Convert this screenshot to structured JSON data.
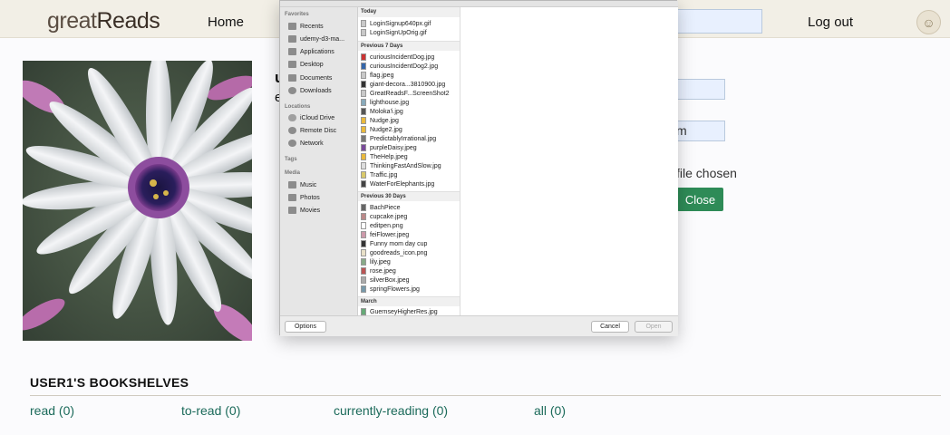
{
  "nav": {
    "logo_part1": "great",
    "logo_part2": "Reads",
    "home": "Home",
    "logout": "Log out",
    "avatar_icon": "user-avatar-icon"
  },
  "profile": {
    "name_fragment": "u",
    "sub_fragment": "e",
    "field2_fragment": "m",
    "file_status": "file chosen",
    "close_button": "Close"
  },
  "bookshelves": {
    "title": "USER1'S BOOKSHELVES",
    "links": [
      "read (0)",
      "to-read (0)",
      "currently-reading (0)",
      "all (0)"
    ]
  },
  "dialog": {
    "sidebar": {
      "favorites_heading": "Favorites",
      "favorites": [
        "Recents",
        "udemy-d3-ma...",
        "Applications",
        "Desktop",
        "Documents",
        "Downloads"
      ],
      "locations_heading": "Locations",
      "locations": [
        "iCloud Drive",
        "Remote Disc",
        "Network"
      ],
      "tags_heading": "Tags",
      "media_heading": "Media",
      "media": [
        "Music",
        "Photos",
        "Movies"
      ]
    },
    "groups": {
      "today": {
        "label": "Today",
        "files": [
          "LoginSignup640px.gif",
          "LoginSignUpOrig.gif"
        ]
      },
      "prev7": {
        "label": "Previous 7 Days",
        "files": [
          "curiousIncidentDog.jpg",
          "curiousIncidentDog2.jpg",
          "flag.jpeg",
          "giant-decora...3810900.jpg",
          "GreatReadsF...ScreenShot2",
          "lighthouse.jpg",
          "Moloka'i.jpg",
          "Nudge.jpg",
          "Nudge2.jpg",
          "PredictablyIrrational.jpg",
          "purpleDaisy.jpeg",
          "TheHelp.jpeg",
          "ThinkingFastAndSlow.jpg",
          "Traffic.jpg",
          "WaterForElephants.jpg"
        ]
      },
      "prev30": {
        "label": "Previous 30 Days",
        "files": [
          "BachPiece",
          "cupcake.jpeg",
          "editpen.png",
          "feiFlower.jpeg",
          "Funny mom day cup",
          "goodreads_icon.png",
          "lily.jpeg",
          "rose.jpeg",
          "silverBox.jpeg",
          "springFlowers.jpg"
        ]
      },
      "march": {
        "label": "March",
        "files": [
          "GuernseyHigherRes.jpg"
        ]
      }
    },
    "buttons": {
      "options": "Options",
      "cancel": "Cancel",
      "open": "Open"
    }
  }
}
